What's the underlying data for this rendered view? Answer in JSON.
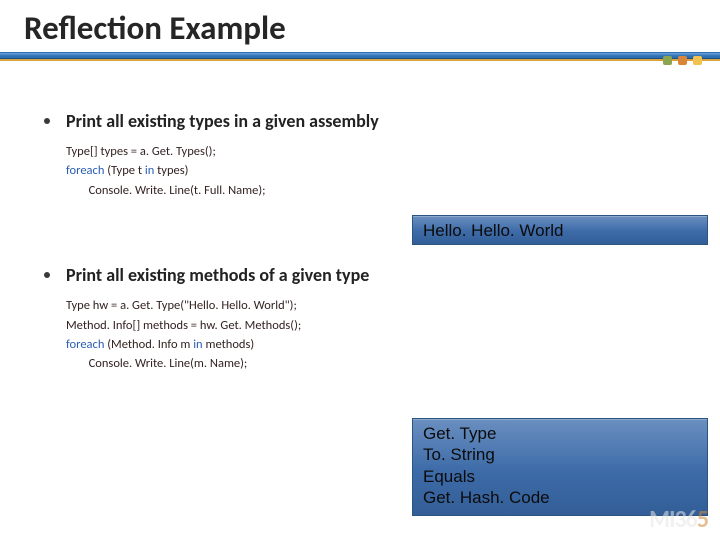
{
  "title": "Reflection Example",
  "bullets": [
    {
      "heading": "Print all existing types in a given assembly",
      "code": {
        "l1": "Type[] types = a. Get. Types();",
        "l2a": "foreach ",
        "l2b": "(Type t ",
        "l2c": "in ",
        "l2d": "types)",
        "l3": "        Console. Write. Line(t. Full. Name);"
      },
      "output": [
        "Hello. Hello. World"
      ]
    },
    {
      "heading": "Print all existing methods of a given type",
      "code": {
        "l1": "Type hw = a. Get. Type(\"Hello. Hello. World\");",
        "l2": "Method. Info[] methods = hw. Get. Methods();",
        "l3a": "foreach ",
        "l3b": "(Method. Info m ",
        "l3c": "in ",
        "l3d": "methods)",
        "l4": "        Console. Write. Line(m. Name);"
      },
      "output": [
        "Get. Type",
        "To. String",
        "Equals",
        "Get. Hash. Code"
      ]
    }
  ],
  "logo": {
    "pre": "MI36",
    "accent": "5"
  }
}
